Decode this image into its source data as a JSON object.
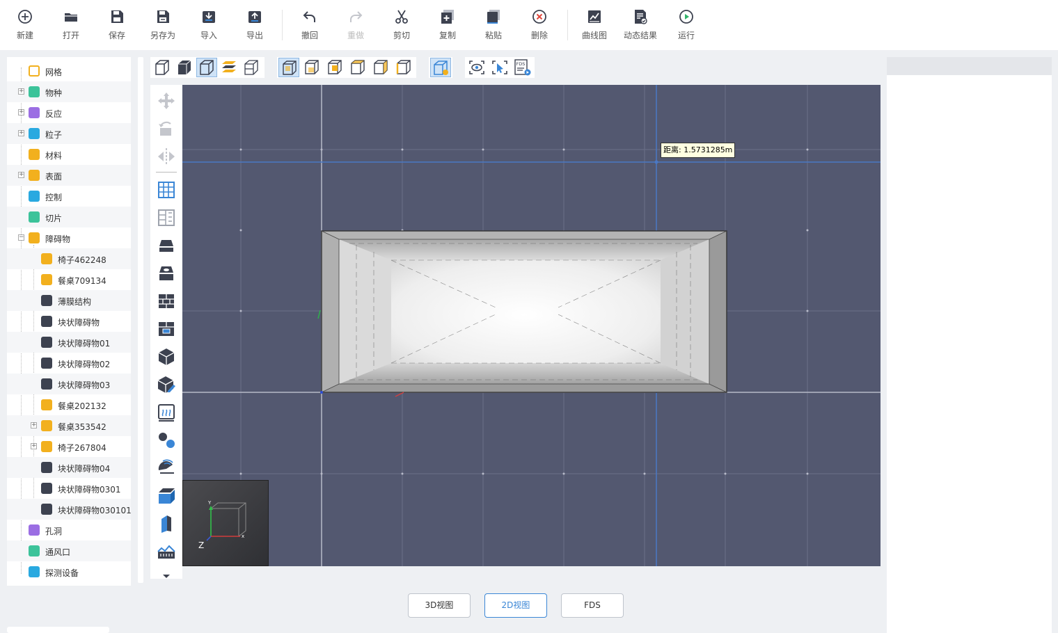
{
  "toolbar": {
    "items": [
      {
        "label": "新建",
        "icon": "plus-circle-icon"
      },
      {
        "label": "打开",
        "icon": "folder-open-icon"
      },
      {
        "label": "保存",
        "icon": "save-icon"
      },
      {
        "label": "另存为",
        "icon": "save-as-icon"
      },
      {
        "label": "导入",
        "icon": "import-icon"
      },
      {
        "label": "导出",
        "icon": "export-icon"
      },
      {
        "label": "撤回",
        "icon": "undo-icon"
      },
      {
        "label": "重做",
        "icon": "redo-icon",
        "disabled": true
      },
      {
        "label": "剪切",
        "icon": "scissors-icon"
      },
      {
        "label": "复制",
        "icon": "copy-icon"
      },
      {
        "label": "粘贴",
        "icon": "paste-icon"
      },
      {
        "label": "删除",
        "icon": "delete-circle-icon"
      },
      {
        "label": "曲线图",
        "icon": "line-chart-icon"
      },
      {
        "label": "动态结果",
        "icon": "dynamic-result-icon"
      },
      {
        "label": "运行",
        "icon": "play-circle-icon"
      }
    ]
  },
  "tree": {
    "items": [
      {
        "label": "网格",
        "icon": "grid-icon",
        "color": "#f2b01e"
      },
      {
        "label": "物种",
        "icon": "species-icon",
        "color": "#3cc39a"
      },
      {
        "label": "反应",
        "icon": "reaction-icon",
        "color": "#9b6ee3"
      },
      {
        "label": "粒子",
        "icon": "particle-icon",
        "color": "#29a9e0"
      },
      {
        "label": "材料",
        "icon": "material-icon",
        "color": "#f2b01e"
      },
      {
        "label": "表面",
        "icon": "surface-icon",
        "color": "#f2b01e"
      },
      {
        "label": "控制",
        "icon": "control-icon",
        "color": "#2aa9e0"
      },
      {
        "label": "切片",
        "icon": "slice-icon",
        "color": "#3cc39a"
      },
      {
        "label": "障碍物",
        "icon": "obstruction-icon",
        "color": "#f2b01e"
      },
      {
        "label": "椅子462248",
        "icon": "furniture-icon",
        "color": "#f2b01e"
      },
      {
        "label": "餐桌709134",
        "icon": "furniture-icon",
        "color": "#f2b01e"
      },
      {
        "label": "薄膜结构",
        "icon": "cube-icon",
        "color": "#3d4250"
      },
      {
        "label": "块状障碍物",
        "icon": "cube-icon",
        "color": "#3d4250"
      },
      {
        "label": "块状障碍物01",
        "icon": "cube-icon",
        "color": "#3d4250"
      },
      {
        "label": "块状障碍物02",
        "icon": "cube-icon",
        "color": "#3d4250"
      },
      {
        "label": "块状障碍物03",
        "icon": "cube-icon",
        "color": "#3d4250"
      },
      {
        "label": "餐桌202132",
        "icon": "furniture-icon",
        "color": "#f2b01e"
      },
      {
        "label": "餐桌353542",
        "icon": "furniture-icon",
        "color": "#f2b01e"
      },
      {
        "label": "椅子267804",
        "icon": "furniture-icon",
        "color": "#f2b01e"
      },
      {
        "label": "块状障碍物04",
        "icon": "cube-icon",
        "color": "#3d4250"
      },
      {
        "label": "块状障碍物0301",
        "icon": "cube-icon",
        "color": "#3d4250"
      },
      {
        "label": "块状障碍物030101",
        "icon": "cube-icon",
        "color": "#3d4250"
      },
      {
        "label": "孔洞",
        "icon": "hole-icon",
        "color": "#9b6ee3"
      },
      {
        "label": "通风口",
        "icon": "vent-icon",
        "color": "#3cc39a"
      },
      {
        "label": "探测设备",
        "icon": "detector-icon",
        "color": "#29a9e0"
      }
    ]
  },
  "viewport": {
    "distance_label": "距离: 1.5731285m",
    "axis_z_label": "Z"
  },
  "view_tabs": [
    {
      "label": "3D视图",
      "active": false
    },
    {
      "label": "2D视图",
      "active": true
    },
    {
      "label": "FDS",
      "active": false
    }
  ],
  "colors": {
    "accent": "#3a86d6",
    "viewport_bg": "#535870",
    "icon_dark": "#3d4250"
  }
}
